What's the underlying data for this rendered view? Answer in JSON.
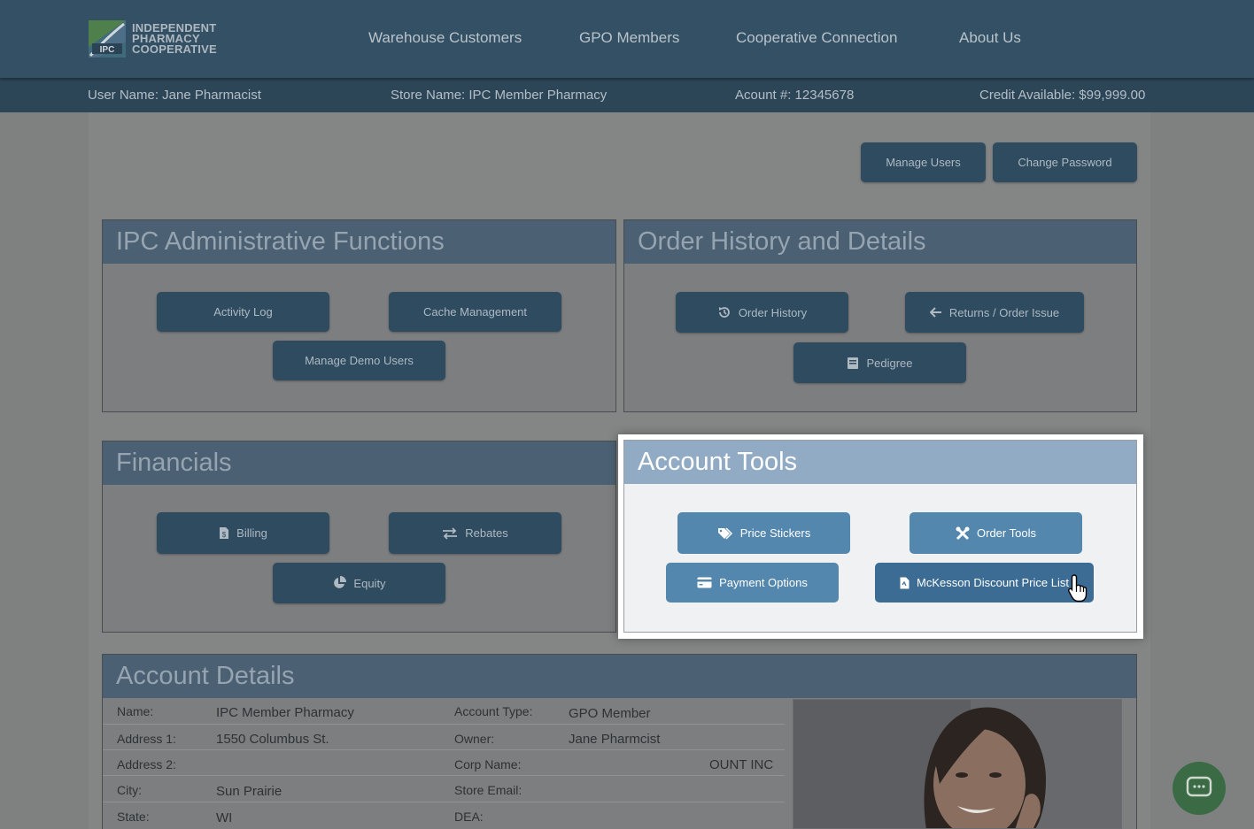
{
  "brand": {
    "logo_abbr": "IPC",
    "logo_lines": [
      "INDEPENDENT",
      "PHARMACY",
      "COOPERATIVE"
    ]
  },
  "nav": {
    "items": [
      "Warehouse Customers",
      "GPO Members",
      "Cooperative Connection",
      "About Us"
    ]
  },
  "userbar": {
    "user_name": "User Name: Jane Pharmacist",
    "store_name": "Store Name: IPC Member Pharmacy",
    "account": "Acount #: 12345678",
    "credit": "Credit Available: $99,999.00"
  },
  "top_buttons": {
    "manage_users": "Manage Users",
    "change_password": "Change Password"
  },
  "admin_panel": {
    "title": "IPC Administrative Functions",
    "activity_log": "Activity Log",
    "cache_management": "Cache Management",
    "manage_demo_users": "Manage Demo Users"
  },
  "order_panel": {
    "title": "Order History and Details",
    "order_history": "Order History",
    "returns": "Returns / Order Issue",
    "pedigree": "Pedigree"
  },
  "financials_panel": {
    "title": "Financials",
    "billing": "Billing",
    "rebates": "Rebates",
    "equity": "Equity"
  },
  "account_tools": {
    "title": "Account Tools",
    "price_stickers": "Price Stickers",
    "order_tools": "Order Tools",
    "payment_options": "Payment Options",
    "mckesson": "McKesson Discount Price List"
  },
  "account_details": {
    "title": "Account Details",
    "left": [
      {
        "label": "Name:",
        "value": "IPC Member Pharmacy"
      },
      {
        "label": "Address 1:",
        "value": "1550 Columbus St."
      },
      {
        "label": "Address 2:",
        "value": ""
      },
      {
        "label": "City:",
        "value": "Sun Prairie"
      },
      {
        "label": "State:",
        "value": "WI"
      }
    ],
    "right": [
      {
        "label": "Account Type:",
        "value": "GPO Member"
      },
      {
        "label": "Owner:",
        "value": "Jane Pharmcist"
      },
      {
        "label": "Corp Name:",
        "value": "OUNT INC"
      },
      {
        "label": "Store Email:",
        "value": ""
      },
      {
        "label": "DEA:",
        "value": ""
      }
    ]
  },
  "colors": {
    "nav_bg": "#345064",
    "highlight_button": "#5487ad",
    "chat_button": "#3a6b45"
  }
}
